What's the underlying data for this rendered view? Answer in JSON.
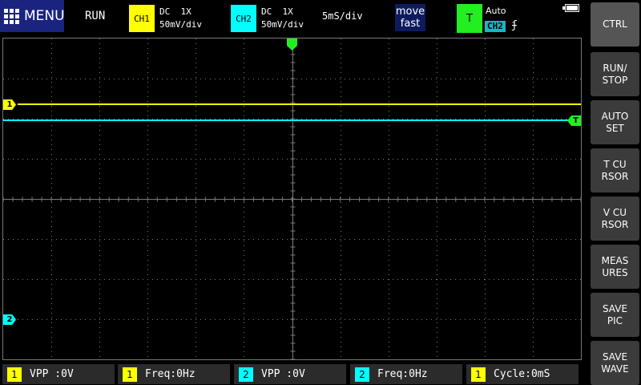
{
  "colors": {
    "ch1": "#ffff00",
    "ch2": "#00ffff",
    "trigger": "#22ee22",
    "grid": "#7a7a7a"
  },
  "topbar": {
    "menu_label": "MENU",
    "run_status": "RUN",
    "ch1": {
      "badge": "CH1",
      "coupling": "DC  1X",
      "scale": "50mV/div"
    },
    "ch2": {
      "badge": "CH2",
      "coupling": "DC  1X",
      "scale": "50mV/div"
    },
    "timebase": "5mS/div",
    "move_line1": "move",
    "move_line2": "fast",
    "trigger_badge": "T",
    "trigger_mode": "Auto",
    "trigger_source": "CH2",
    "trigger_edge": "ʄ",
    "battery_level": 1.0
  },
  "screen": {
    "ch1_marker": "1",
    "ch2_marker": "2",
    "trigger_marker": "T"
  },
  "side_buttons": [
    {
      "label": "CTRL"
    },
    {
      "label": "RUN/\nSTOP"
    },
    {
      "label": "AUTO\nSET"
    },
    {
      "label": "T CU\nRSOR"
    },
    {
      "label": "V CU\nRSOR"
    },
    {
      "label": "MEAS\nURES"
    },
    {
      "label": "SAVE\nPIC"
    },
    {
      "label": "SAVE\nWAVE"
    }
  ],
  "measurements": [
    {
      "channel": "1",
      "text": "VPP :0V"
    },
    {
      "channel": "1",
      "text": "Freq:0Hz"
    },
    {
      "channel": "2",
      "text": "VPP :0V"
    },
    {
      "channel": "2",
      "text": "Freq:0Hz"
    },
    {
      "channel": "1",
      "text": "Cycle:0mS"
    }
  ]
}
